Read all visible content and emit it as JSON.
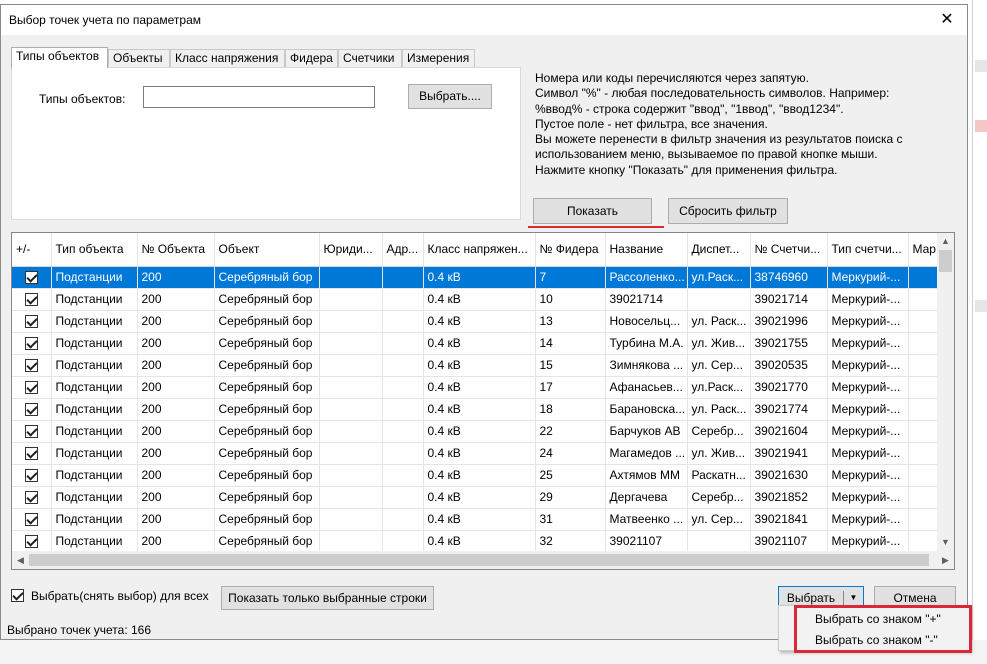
{
  "window": {
    "title": "Выбор точек учета по параметрам",
    "close_glyph": "✕"
  },
  "tabs": [
    "Типы объектов",
    "Объекты",
    "Класс напряжения",
    "Фидера",
    "Счетчики",
    "Измерения"
  ],
  "filter": {
    "label": "Типы объектов:",
    "value": "",
    "select_button": "Выбрать...."
  },
  "info_lines": [
    "Номера или коды перечисляются через запятую.",
    "Символ \"%\" - любая последовательность символов. Например:",
    "%ввод% - строка содержит \"ввод\", \"1ввод\", \"ввод1234\".",
    "Пустое поле - нет фильтра, все значения.",
    "Вы можете перенести в фильтр значения  из результатов поиска с",
    "использованием меню, вызываемое по правой кнопке мыши.",
    "Нажмите кнопку \"Показать\" для применения фильтра."
  ],
  "buttons": {
    "show": "Показать",
    "reset": "Сбросить фильтр",
    "show_selected_only": "Показать только выбранные строки",
    "choose": "Выбрать",
    "cancel": "Отмена"
  },
  "select_all_label": "Выбрать(снять выбор) для всех",
  "status": "Выбрано точек учета: 166",
  "dropdown_menu": [
    "Выбрать со знаком \"+\"",
    "Выбрать со знаком \"-\""
  ],
  "table": {
    "columns": [
      "+/-",
      "Тип объекта",
      "№ Объекта",
      "Объект",
      "Юриди...",
      "Адр...",
      "Класс напряжен...",
      "№ Фидера",
      "Название",
      "Диспет...",
      "№ Счетчи...",
      "Тип счетчи...",
      "Мар"
    ],
    "rows": [
      [
        "",
        "Подстанции",
        "200",
        "Серебряный бор",
        "",
        "",
        "0.4 кВ",
        "7",
        "Рассоленко...",
        "ул.Раск...",
        "38746960",
        "Меркурий-..."
      ],
      [
        "",
        "Подстанции",
        "200",
        "Серебряный бор",
        "",
        "",
        "0.4 кВ",
        "10",
        "39021714",
        "",
        "39021714",
        "Меркурий-..."
      ],
      [
        "",
        "Подстанции",
        "200",
        "Серебряный бор",
        "",
        "",
        "0.4 кВ",
        "13",
        "Новосельц...",
        "ул. Раск...",
        "39021996",
        "Меркурий-..."
      ],
      [
        "",
        "Подстанции",
        "200",
        "Серебряный бор",
        "",
        "",
        "0.4 кВ",
        "14",
        "Турбина М.А.",
        "ул. Жив...",
        "39021755",
        "Меркурий-..."
      ],
      [
        "",
        "Подстанции",
        "200",
        "Серебряный бор",
        "",
        "",
        "0.4 кВ",
        "15",
        "Зимнякова ...",
        "ул. Сер...",
        "39020535",
        "Меркурий-..."
      ],
      [
        "",
        "Подстанции",
        "200",
        "Серебряный бор",
        "",
        "",
        "0.4 кВ",
        "17",
        "Афанасьев...",
        "ул.Раск...",
        "39021770",
        "Меркурий-..."
      ],
      [
        "",
        "Подстанции",
        "200",
        "Серебряный бор",
        "",
        "",
        "0.4 кВ",
        "18",
        "Барановска...",
        "ул. Раск...",
        "39021774",
        "Меркурий-..."
      ],
      [
        "",
        "Подстанции",
        "200",
        "Серебряный бор",
        "",
        "",
        "0.4 кВ",
        "22",
        "Барчуков АВ",
        "Серебр...",
        "39021604",
        "Меркурий-..."
      ],
      [
        "",
        "Подстанции",
        "200",
        "Серебряный бор",
        "",
        "",
        "0.4 кВ",
        "24",
        "Магамедов ...",
        "ул. Жив...",
        "39021941",
        "Меркурий-..."
      ],
      [
        "",
        "Подстанции",
        "200",
        "Серебряный бор",
        "",
        "",
        "0.4 кВ",
        "25",
        "Ахтямов ММ",
        "Раскатн...",
        "39021630",
        "Меркурий-..."
      ],
      [
        "",
        "Подстанции",
        "200",
        "Серебряный бор",
        "",
        "",
        "0.4 кВ",
        "29",
        "Дергачева",
        "Серебр...",
        "39021852",
        "Меркурий-..."
      ],
      [
        "",
        "Подстанции",
        "200",
        "Серебряный бор",
        "",
        "",
        "0.4 кВ",
        "31",
        "Матвеенко ...",
        "ул. Сер...",
        "39021841",
        "Меркурий-..."
      ],
      [
        "",
        "Подстанции",
        "200",
        "Серебряный бор",
        "",
        "",
        "0.4 кВ",
        "32",
        "39021107",
        "",
        "39021107",
        "Меркурий-..."
      ]
    ]
  },
  "colors": {
    "selection": "#0078d7",
    "highlight_red": "#d8283a"
  }
}
